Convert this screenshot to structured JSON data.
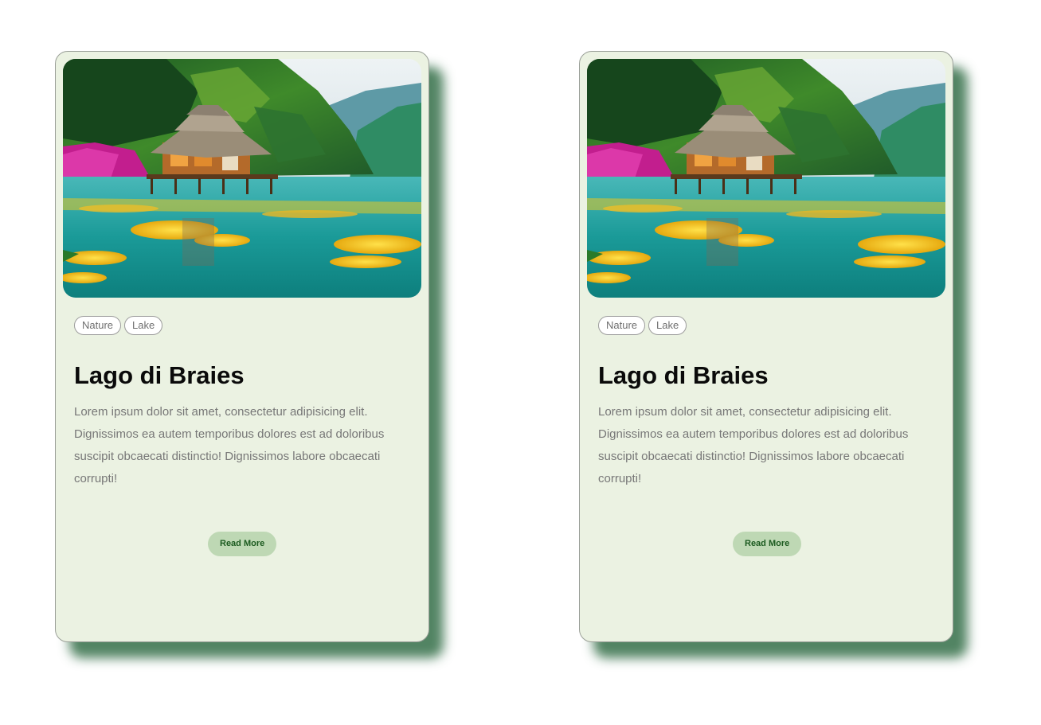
{
  "cards": [
    {
      "image": {
        "icon": "lake-landscape-image"
      },
      "tags": [
        "Nature",
        "Lake"
      ],
      "title": "Lago di Braies",
      "description": "Lorem ipsum dolor sit amet, consectetur adipisicing elit. Dignissimos ea autem temporibus dolores est ad doloribus suscipit obcaecati distinctio! Dignissimos labore obcaecati corrupti!",
      "button_label": "Read More"
    },
    {
      "image": {
        "icon": "lake-landscape-image"
      },
      "tags": [
        "Nature",
        "Lake"
      ],
      "title": "Lago di Braies",
      "description": "Lorem ipsum dolor sit amet, consectetur adipisicing elit. Dignissimos ea autem temporibus dolores est ad doloribus suscipit obcaecati distinctio! Dignissimos labore obcaecati corrupti!",
      "button_label": "Read More"
    }
  ],
  "colors": {
    "card_background": "#ebf2e2",
    "card_shadow": "#346e48",
    "button_background": "#bed8b4",
    "button_text": "#1b5a1f"
  }
}
